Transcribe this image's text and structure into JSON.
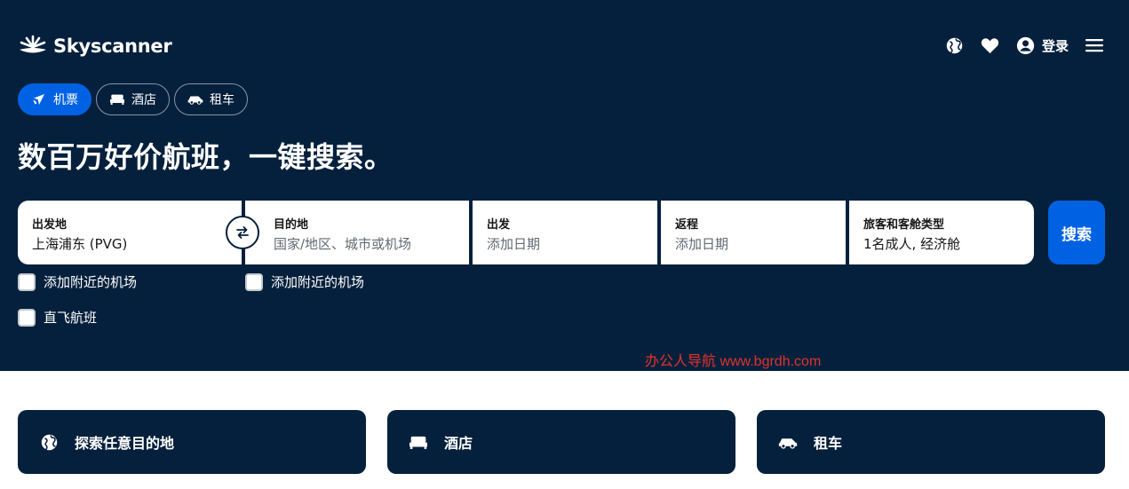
{
  "brand": {
    "name": "Skyscanner"
  },
  "nav": {
    "login_label": "登录"
  },
  "tabs": [
    {
      "label": "机票",
      "icon": "plane-icon",
      "active": true
    },
    {
      "label": "酒店",
      "icon": "bed-icon",
      "active": false
    },
    {
      "label": "租车",
      "icon": "car-icon",
      "active": false
    }
  ],
  "headline": "数百万好价航班，一键搜索。",
  "search": {
    "origin": {
      "label": "出发地",
      "value": "上海浦东 (PVG)"
    },
    "destination": {
      "label": "目的地",
      "placeholder": "国家/地区、城市或机场"
    },
    "depart": {
      "label": "出发",
      "placeholder": "添加日期"
    },
    "return": {
      "label": "返程",
      "placeholder": "添加日期"
    },
    "travellers": {
      "label": "旅客和客舱类型",
      "value": "1名成人, 经济舱"
    },
    "button_label": "搜索"
  },
  "options": {
    "nearby_origin": {
      "label": "添加附近的机场",
      "checked": false
    },
    "nearby_destination": {
      "label": "添加附近的机场",
      "checked": false
    },
    "direct_only": {
      "label": "直飞航班",
      "checked": false
    }
  },
  "watermark": "办公人导航 www.bgrdh.com",
  "cards": [
    {
      "label": "探索任意目的地",
      "icon": "globe-icon"
    },
    {
      "label": "酒店",
      "icon": "bed-icon"
    },
    {
      "label": "租车",
      "icon": "car-icon"
    }
  ],
  "colors": {
    "hero_bg": "#05203c",
    "accent": "#0062e3",
    "watermark": "#e0322b"
  }
}
